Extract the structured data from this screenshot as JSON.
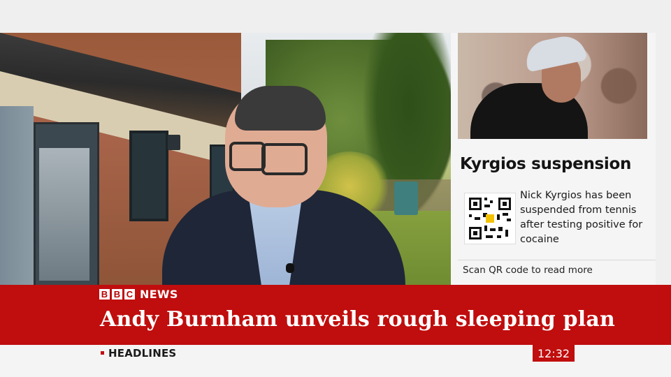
{
  "sidebar": {
    "headline": "Kyrgios suspension",
    "summary": "Nick Kyrgios has been suspended from tennis after testing positive for cocaine",
    "qr_prompt": "Scan QR code to read more",
    "photo_icon": "tennis-player-photo"
  },
  "brand": {
    "letters": [
      "B",
      "B",
      "C"
    ],
    "label": "NEWS",
    "accent_color": "#c00d0d"
  },
  "headline": {
    "text": "Andy Burnham unveils rough sleeping plan"
  },
  "ticker": {
    "label": "HEADLINES",
    "clock": "12:32"
  }
}
